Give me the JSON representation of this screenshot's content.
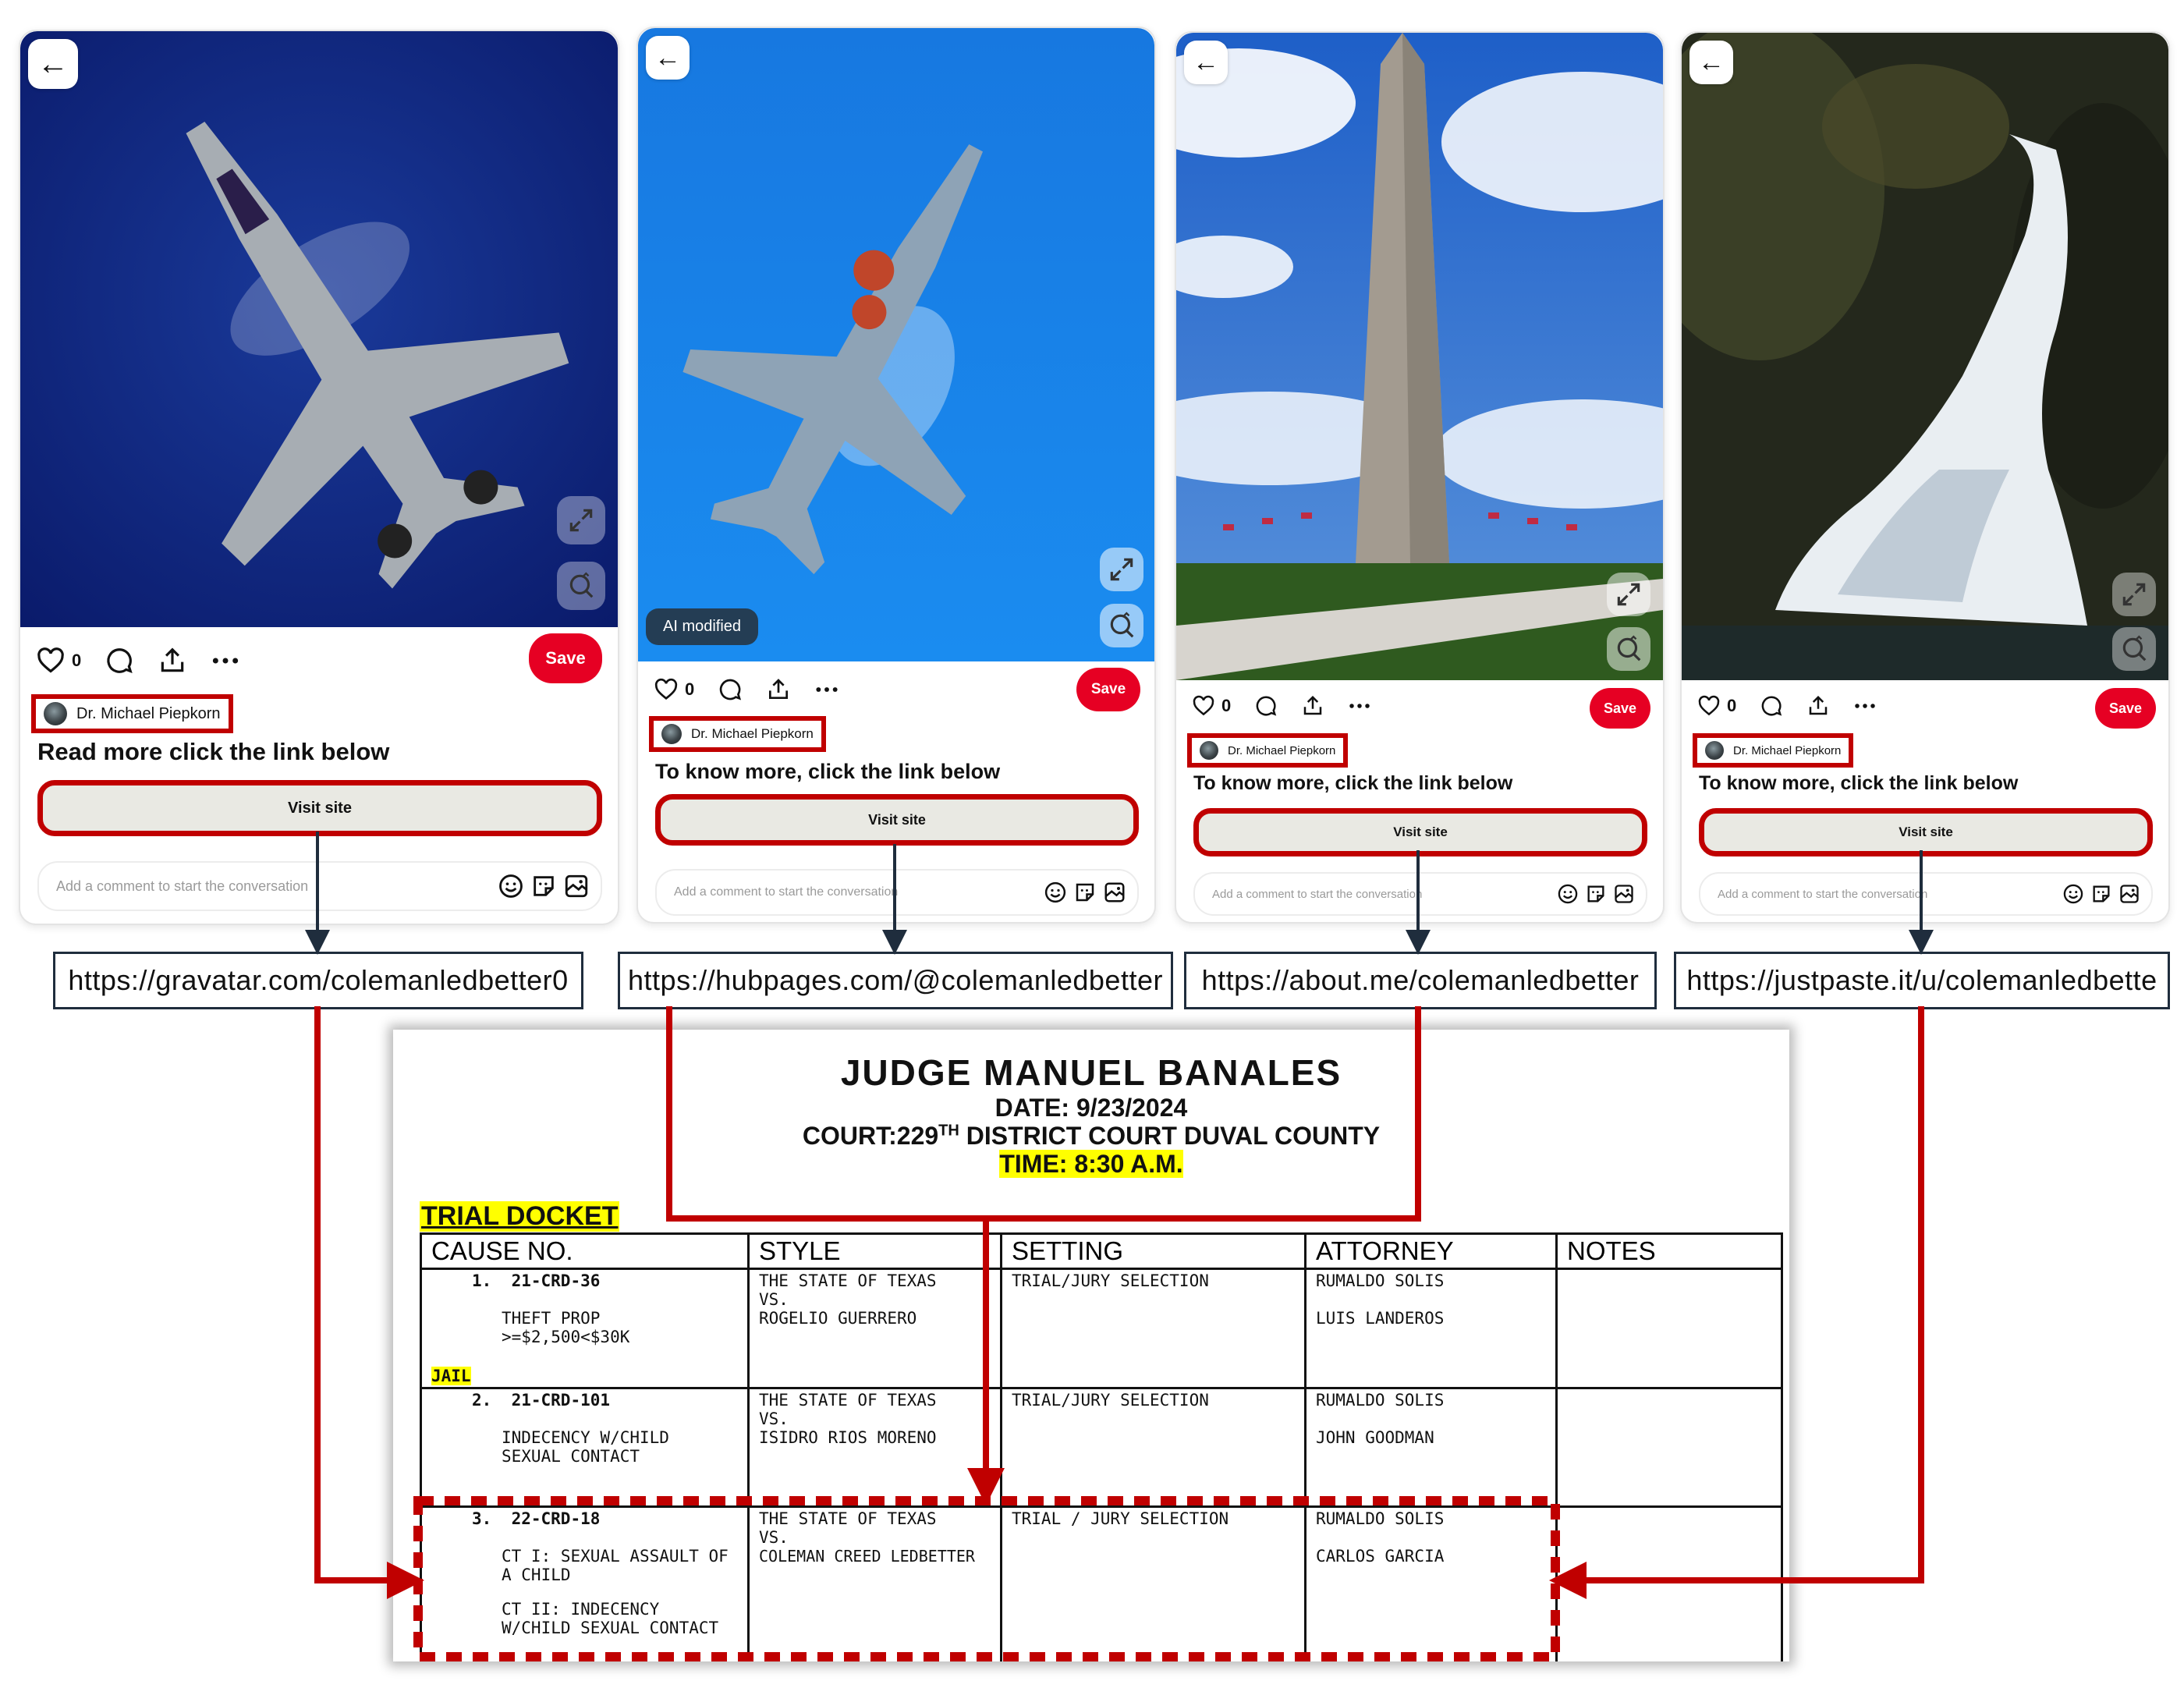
{
  "cards": [
    {
      "id": "card1",
      "likes": "0",
      "save_label": "Save",
      "author": "Dr. Michael Piepkorn",
      "caption": "Read more click the link below",
      "visit_label": "Visit site",
      "comment_placeholder": "Add a comment to start the conversation",
      "photo": "fighter-jet-dark-sky"
    },
    {
      "id": "card2",
      "likes": "0",
      "save_label": "Save",
      "ai_badge": "AI modified",
      "author": "Dr. Michael Piepkorn",
      "caption": "To know more, click the link below",
      "visit_label": "Visit site",
      "comment_placeholder": "Add a comment to start the conversation",
      "photo": "fighter-jet-blue-sky"
    },
    {
      "id": "card3",
      "likes": "0",
      "save_label": "Save",
      "author": "Dr. Michael Piepkorn",
      "caption": "To know more, click the link below",
      "visit_label": "Visit site",
      "comment_placeholder": "Add a comment to start the conversation",
      "photo": "washington-monument"
    },
    {
      "id": "card4",
      "likes": "0",
      "save_label": "Save",
      "author": "Dr. Michael Piepkorn",
      "caption": "To know more, click the link below",
      "visit_label": "Visit site",
      "comment_placeholder": "Add a comment to start the conversation",
      "photo": "waterfall"
    }
  ],
  "urls": [
    "https://gravatar.com/colemanledbetter0",
    "https://hubpages.com/@colemanledbetter",
    "https://about.me/colemanledbetter",
    "https://justpaste.it/u/colemanledbette"
  ],
  "docket": {
    "judge": "JUDGE MANUEL BANALES",
    "date": "DATE: 9/23/2024",
    "court_prefix": "COURT:229",
    "court_sup": "TH",
    "court_suffix": " DISTRICT COURT DUVAL COUNTY",
    "time": "TIME: 8:30 A.M.",
    "section": "TRIAL DOCKET",
    "columns": [
      "CAUSE NO.",
      "STYLE",
      "SETTING",
      "ATTORNEY",
      "NOTES"
    ],
    "rows": [
      {
        "num": "1.",
        "cause": "21-CRD-36",
        "charges": [
          "THEFT PROP >=$2,500<$30K"
        ],
        "tag": "JAIL",
        "style": [
          "THE STATE OF TEXAS",
          "VS.",
          "ROGELIO GUERRERO"
        ],
        "setting": "TRIAL/JURY SELECTION",
        "attorneys": [
          "RUMALDO SOLIS",
          "LUIS LANDEROS"
        ],
        "notes": ""
      },
      {
        "num": "2.",
        "cause": "21-CRD-101",
        "charges": [
          "INDECENCY W/CHILD SEXUAL CONTACT"
        ],
        "tag": "",
        "style": [
          "THE STATE OF TEXAS",
          "VS.",
          "ISIDRO RIOS MORENO"
        ],
        "setting": "TRIAL/JURY SELECTION",
        "attorneys": [
          "RUMALDO SOLIS",
          "JOHN GOODMAN"
        ],
        "notes": ""
      },
      {
        "num": "3.",
        "cause": "22-CRD-18",
        "charges": [
          "CT I: SEXUAL ASSAULT OF A CHILD",
          "CT II: INDECENCY W/CHILD SEXUAL CONTACT"
        ],
        "tag": "",
        "style": [
          "THE STATE OF TEXAS",
          "VS.",
          "COLEMAN CREED LEDBETTER"
        ],
        "setting": "TRIAL / JURY SELECTION",
        "attorneys": [
          "RUMALDO SOLIS",
          "CARLOS GARCIA"
        ],
        "notes": ""
      }
    ]
  },
  "colors": {
    "highlight_red": "#c00000",
    "save_red": "#e60023",
    "marker_yellow": "#ffff00",
    "url_border": "#1f2d3d"
  }
}
